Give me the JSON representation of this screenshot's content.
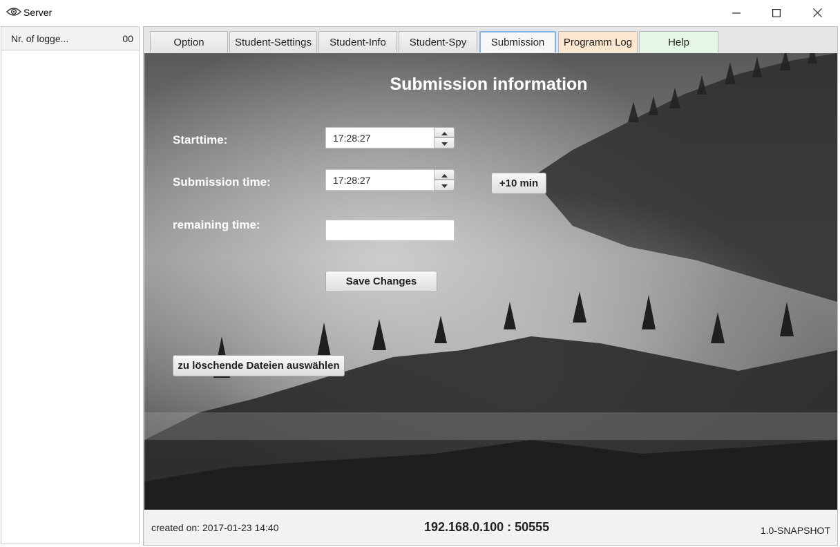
{
  "window": {
    "title": "Server",
    "icons": {
      "app": "eye-icon",
      "minimize": "minimize-icon",
      "maximize": "maximize-icon",
      "close": "close-icon"
    }
  },
  "sidebar": {
    "header_label": "Nr. of logge...",
    "count": "00"
  },
  "tabs": [
    {
      "label": "Option"
    },
    {
      "label": "Student-Settings"
    },
    {
      "label": "Student-Info"
    },
    {
      "label": "Student-Spy"
    },
    {
      "label": "Submission"
    },
    {
      "label": "Programm Log"
    },
    {
      "label": "Help"
    }
  ],
  "active_tab": "Submission",
  "submission": {
    "heading": "Submission information",
    "starttime_label": "Starttime:",
    "starttime_value": "17:28:27",
    "submission_time_label": "Submission time:",
    "submission_time_value": "17:28:27",
    "remaining_time_label": "remaining time:",
    "remaining_time_value": "",
    "add_10_min_label": "+10 min",
    "save_changes_label": "Save Changes",
    "select_files_label": "zu löschende Dateien auswählen"
  },
  "footer": {
    "created": "created on: 2017-01-23 14:40",
    "address": "192.168.0.100 : 50555",
    "version": "1.0-SNAPSHOT"
  },
  "colors": {
    "active_tab_border": "#7fb2e5",
    "log_tab_bg": "#fbe6cf",
    "help_tab_bg": "#e6f7e6"
  }
}
